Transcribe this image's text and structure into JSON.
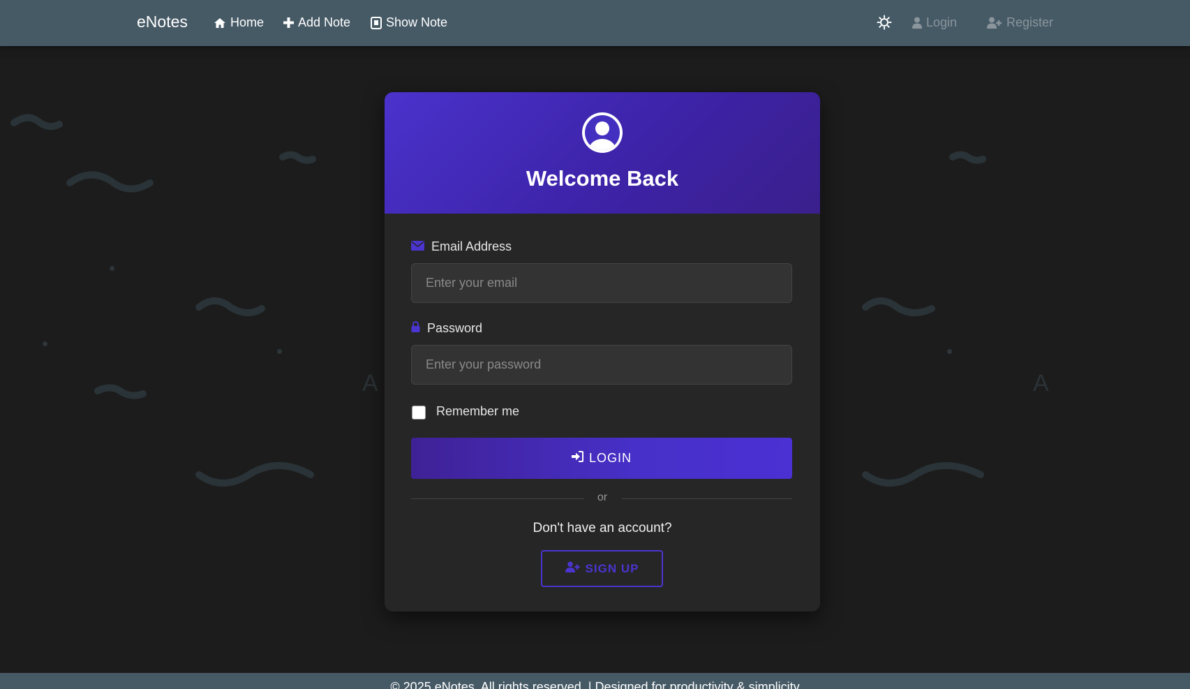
{
  "navbar": {
    "brand": "eNotes",
    "links": [
      {
        "label": "Home",
        "icon": "home-icon"
      },
      {
        "label": "Add Note",
        "icon": "plus-icon"
      },
      {
        "label": "Show Note",
        "icon": "note-icon"
      }
    ],
    "theme_toggle_icon": "sun-icon",
    "login_label": "Login",
    "register_label": "Register"
  },
  "background": {
    "glyph": "A"
  },
  "card": {
    "avatar_icon": "user-circle-icon",
    "title": "Welcome Back",
    "email": {
      "label": "Email Address",
      "icon": "envelope-icon",
      "placeholder": "Enter your email",
      "value": ""
    },
    "password": {
      "label": "Password",
      "icon": "lock-icon",
      "placeholder": "Enter your password",
      "value": ""
    },
    "remember": {
      "label": "Remember me",
      "checked": false
    },
    "login_button": "LOGIN",
    "divider": "or",
    "signup_prompt": "Don't have an account?",
    "signup_button": "SIGN UP"
  },
  "footer": {
    "text": "© 2025 eNotes. All rights reserved. | Designed for productivity & simplicity"
  },
  "colors": {
    "accent": "#4a35cf",
    "navbar": "#465a66",
    "background": "#1c1c1c",
    "card": "#262626"
  }
}
